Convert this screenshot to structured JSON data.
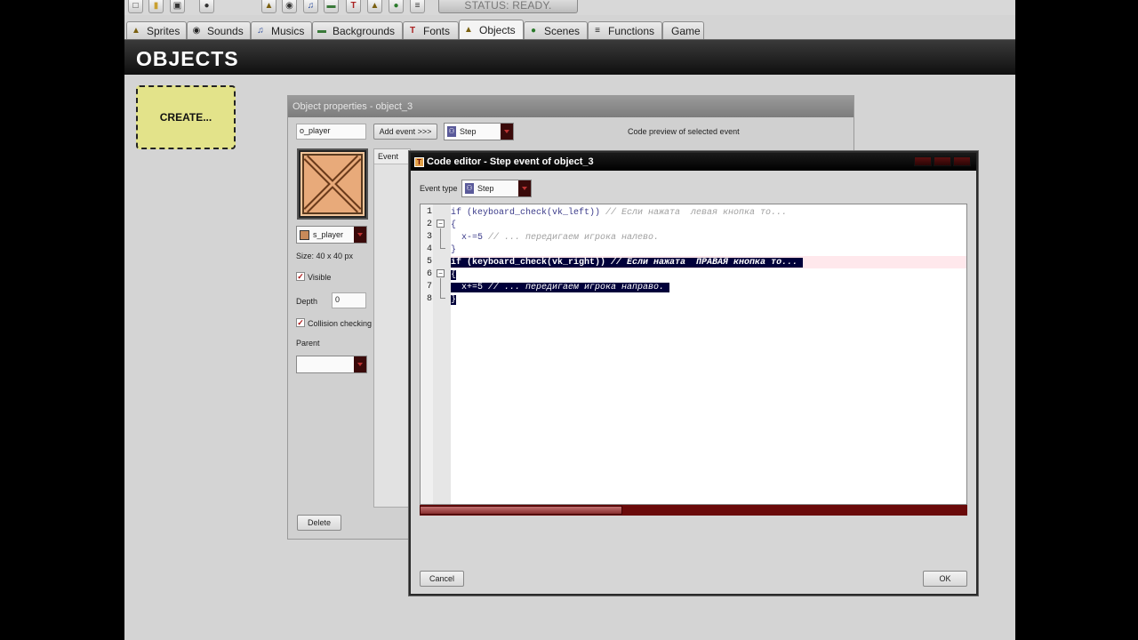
{
  "status": "STATUS: READY.",
  "tabs": [
    {
      "label": "Sprites",
      "icon": "sprite-icon"
    },
    {
      "label": "Sounds",
      "icon": "sound-icon"
    },
    {
      "label": "Musics",
      "icon": "music-icon"
    },
    {
      "label": "Backgrounds",
      "icon": "background-icon"
    },
    {
      "label": "Fonts",
      "icon": "font-icon"
    },
    {
      "label": "Objects",
      "icon": "object-icon"
    },
    {
      "label": "Scenes",
      "icon": "scene-icon"
    },
    {
      "label": "Functions",
      "icon": "function-icon"
    },
    {
      "label": "Game",
      "icon": ""
    }
  ],
  "active_tab": "Objects",
  "page_title": "OBJECTS",
  "create_label": "CREATE...",
  "object_props": {
    "title": "Object properties - object_3",
    "name_value": "o_player",
    "add_event_label": "Add event >>>",
    "event_select": "Step",
    "preview_label": "Code preview of selected event",
    "event_column": "Event",
    "sprite_select": "s_player",
    "size_text": "Size: 40 x 40 px",
    "visible_label": "Visible",
    "visible_checked": true,
    "depth_label": "Depth",
    "depth_value": "0",
    "collision_label": "Collision checking",
    "collision_checked": true,
    "parent_label": "Parent",
    "parent_value": "",
    "delete_label": "Delete"
  },
  "code_editor": {
    "title": "Code editor - Step event of object_3",
    "event_type_label": "Event type",
    "event_type_value": "Step",
    "cancel_label": "Cancel",
    "ok_label": "OK",
    "lines": [
      {
        "n": "1",
        "code": "if (keyboard_check(vk_left))",
        "comment": " // Если нажата  левая кнопка то..."
      },
      {
        "n": "2",
        "code": "{",
        "comment": ""
      },
      {
        "n": "3",
        "code": "  x-=5",
        "comment": " // ... передигаем игрока налево."
      },
      {
        "n": "4",
        "code": "}",
        "comment": ""
      },
      {
        "n": "5",
        "code": "if (keyboard_check(vk_right))",
        "comment": " // Если нажата  ПРАВАЯ кнопка то..."
      },
      {
        "n": "6",
        "code": "{",
        "comment": ""
      },
      {
        "n": "7",
        "code": "  x+=5",
        "comment": " // ... передигаем игрока направо."
      },
      {
        "n": "8",
        "code": "}",
        "comment": ""
      }
    ]
  }
}
